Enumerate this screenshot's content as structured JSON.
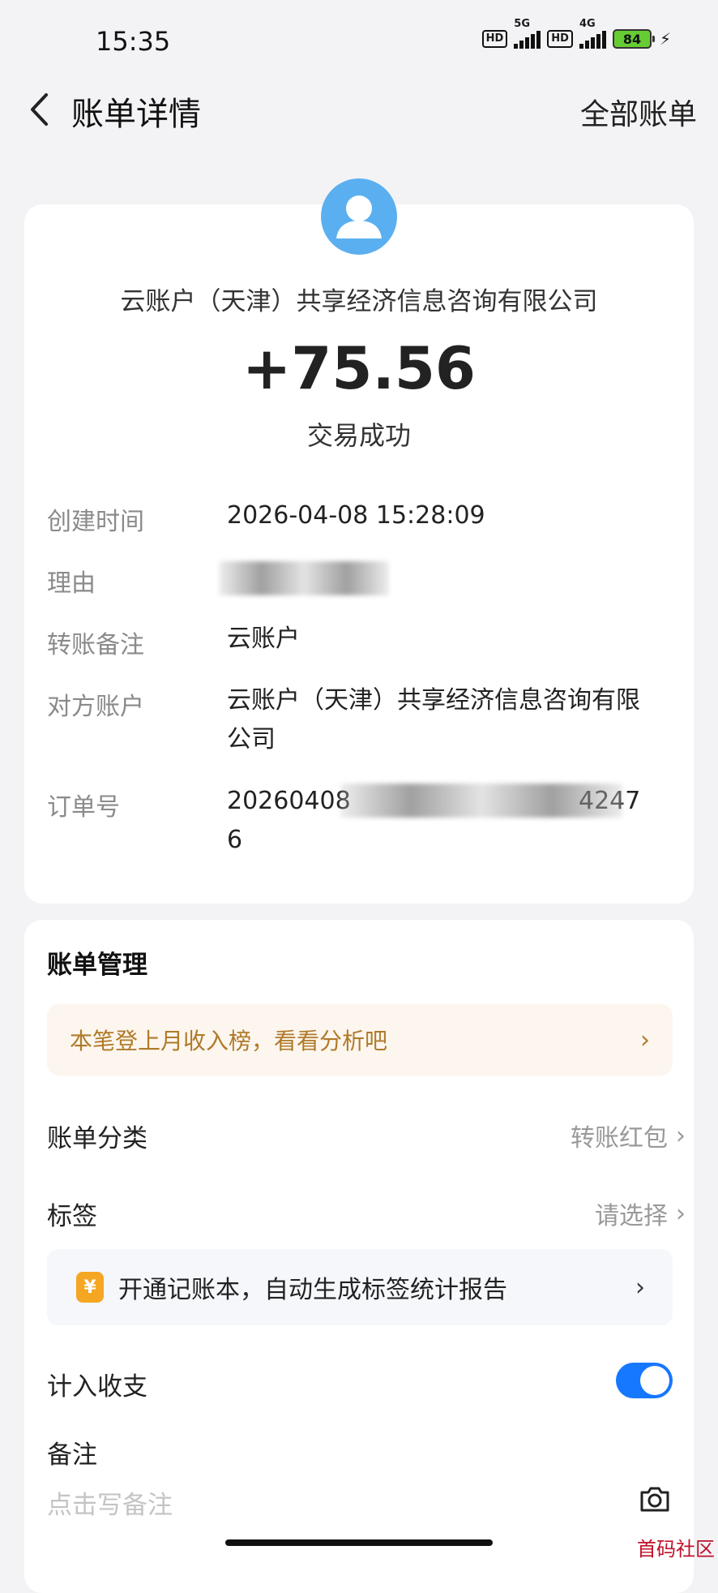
{
  "status_bar": {
    "time": "15:35",
    "hd1": "HD",
    "net1": "5G",
    "hd2": "HD",
    "net2": "4G",
    "battery": "84"
  },
  "header": {
    "title": "账单详情",
    "all_bills": "全部账单"
  },
  "summary": {
    "company": "云账户（天津）共享经济信息咨询有限公司",
    "amount": "+75.56",
    "status": "交易成功"
  },
  "details": {
    "created_label": "创建时间",
    "created_value": "2026-04-08 15:28:09",
    "reason_label": "理由",
    "remark_label": "转账备注",
    "remark_value": "云账户",
    "counterparty_label": "对方账户",
    "counterparty_line1": "云账户（天津）共享经济信息咨询有限",
    "counterparty_line2": "公司",
    "order_label": "订单号",
    "order_prefix": "20260408",
    "order_suffix": "4247",
    "order_line2": "6"
  },
  "management": {
    "title": "账单管理",
    "banner": "本笔登上月收入榜，看看分析吧",
    "category_label": "账单分类",
    "category_value": "转账红包",
    "tag_label": "标签",
    "tag_value": "请选择",
    "promo_icon": "¥",
    "promo": "开通记账本，自动生成标签统计报告",
    "include_label": "计入收支",
    "include_on": true,
    "note_label": "备注",
    "note_placeholder": "点击写备注"
  },
  "watermark": "首码社区",
  "colors": {
    "accent": "#1677ff",
    "avatar": "#5aaff0",
    "banner_text": "#b07a2a",
    "banner_bg": "#fcf6ee"
  }
}
